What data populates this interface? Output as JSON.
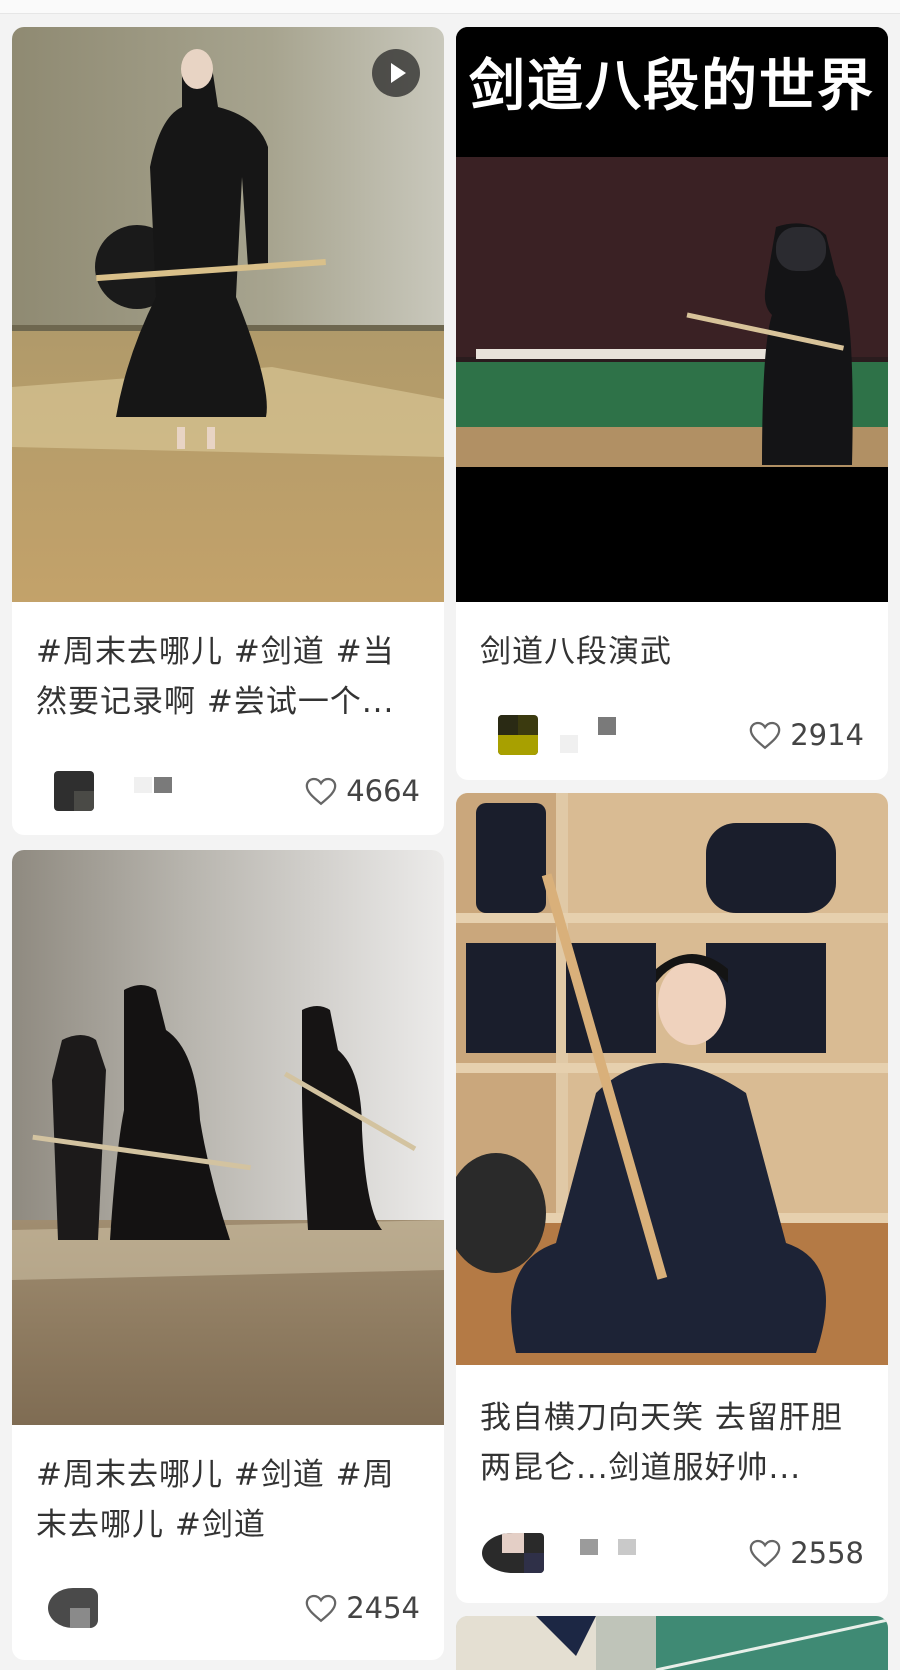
{
  "feed": {
    "posts": [
      {
        "title": "#周末去哪儿 #剑道 #当然要记录啊 #尝试一个...",
        "likes": "4664",
        "is_video": true
      },
      {
        "title": "剑道八段演武",
        "likes": "2914",
        "cover_caption": "剑道八段的世界",
        "is_video": false
      },
      {
        "title": "#周末去哪儿 #剑道 #周末去哪儿 #剑道",
        "likes": "2454",
        "is_video": false
      },
      {
        "title": "我自横刀向天笑 去留肝胆两昆仑...剑道服好帅...",
        "likes": "2558",
        "is_video": false
      }
    ]
  },
  "icons": {
    "like": "heart-outline-icon",
    "video": "play-icon"
  },
  "colors": {
    "background": "#f3f3f3",
    "card": "#ffffff",
    "text": "#333333",
    "icon": "#666666"
  }
}
